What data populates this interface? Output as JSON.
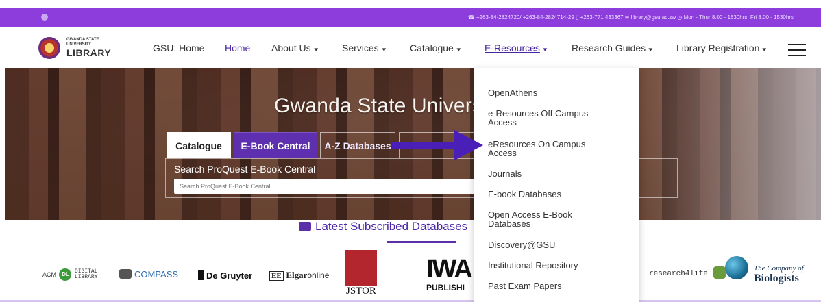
{
  "topbar": {
    "facebook_icon": "facebook-icon",
    "contact": "☎ +263-84-2824720/ +263-84-2824714-29  ▯ +263-771 433367  ✉ library@gsu.ac.zw  ◷ Mon - Thur 8.00 - 1630hrs; Fri 8.00 - 1530hrs"
  },
  "logo": {
    "line1": "GWANDA STATE UNIVERSITY",
    "line2": "LIBRARY"
  },
  "nav": {
    "items": [
      {
        "label": "GSU: Home"
      },
      {
        "label": "Home"
      },
      {
        "label": "About Us"
      },
      {
        "label": "Services"
      },
      {
        "label": "Catalogue"
      },
      {
        "label": "E-Resources"
      },
      {
        "label": "Research Guides"
      },
      {
        "label": "Library Registration"
      }
    ],
    "chevron": "▾"
  },
  "hero": {
    "title": "Gwanda State Univers",
    "tabs": [
      "Catalogue",
      "E-Book Central",
      "A-Z Databases",
      "Past Exam"
    ],
    "search_label": "Search ProQuest E-Book Central",
    "search_placeholder": "Search ProQuest E-Book Central"
  },
  "section": {
    "heading": "Latest Subscribed Databases"
  },
  "logos": {
    "acm_prefix": "ACM",
    "acm_dl": "DL",
    "acm_digital": "DIGITAL",
    "acm_library": "LIBRARY",
    "compass": "COMPASS",
    "degruyter": "De Gruyter",
    "ee": "EE",
    "elgar": "Elgar",
    "online": "online",
    "jstor": "JSTOR",
    "iwa": "IWA",
    "publishing": "PUBLISHI",
    "research4life": "research4life",
    "company_the": "The",
    "company_of": "Company of",
    "biologists": "Biologists"
  },
  "dropdown": {
    "items": [
      "OpenAthens",
      "e-Resources Off Campus Access",
      "eResources On Campus Access",
      "Journals",
      "E-book Databases",
      "Open Access E-Book Databases",
      "Discovery@GSU",
      "Institutional Repository",
      "Past Exam Papers"
    ]
  },
  "colors": {
    "brand_purple": "#8d3ddc",
    "nav_active": "#4a26a3",
    "arrow": "#4a1fb8"
  }
}
